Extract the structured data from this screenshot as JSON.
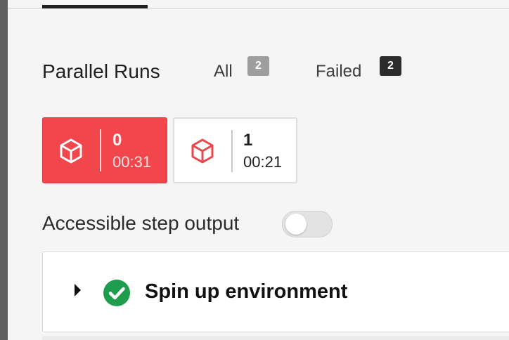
{
  "header": {
    "title": "Parallel Runs"
  },
  "filters": [
    {
      "label": "All",
      "count": "2"
    },
    {
      "label": "Failed",
      "count": "2"
    }
  ],
  "runs": [
    {
      "index": "0",
      "duration": "00:31",
      "status": "failed"
    },
    {
      "index": "1",
      "duration": "00:21",
      "status": "failed"
    }
  ],
  "accessible_output": {
    "label": "Accessible step output",
    "enabled": false
  },
  "steps": [
    {
      "title": "Spin up environment",
      "status": "success",
      "icon": "check-circle-icon"
    }
  ],
  "colors": {
    "failed_red": "#f1474c",
    "success_green": "#1f9d4f",
    "badge_dark": "#2b2b2b",
    "badge_gray": "#9e9e9e"
  }
}
